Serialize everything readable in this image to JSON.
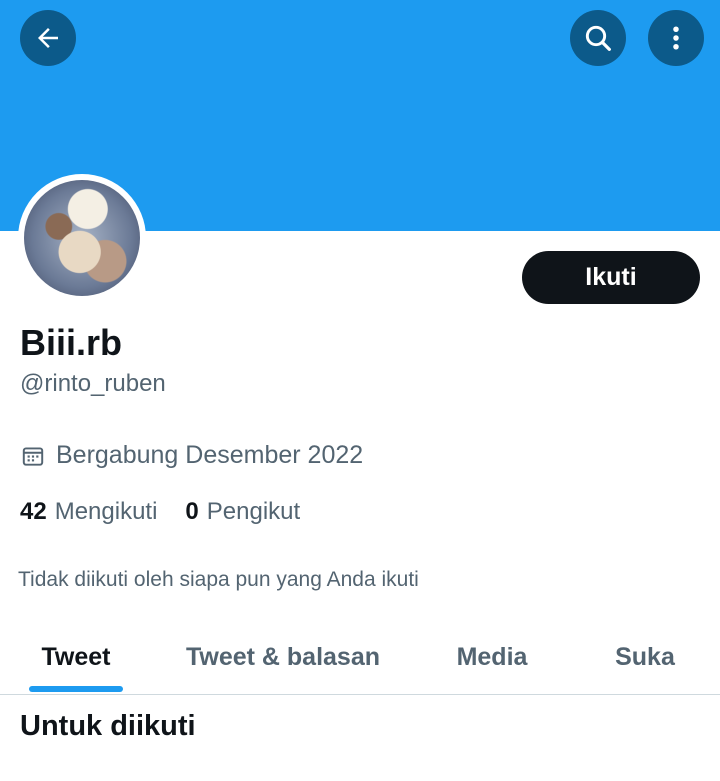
{
  "header": {
    "banner_color": "#1d9bf0",
    "back_icon": "arrow-left-icon",
    "search_icon": "search-icon",
    "more_icon": "more-vertical-icon"
  },
  "profile": {
    "display_name": "Biii.rb",
    "handle": "@rinto_ruben",
    "follow_label": "Ikuti",
    "joined_icon": "calendar-icon",
    "joined_text": "Bergabung Desember 2022",
    "following_count": "42",
    "following_label": "Mengikuti",
    "followers_count": "0",
    "followers_label": "Pengikut",
    "not_followed_text": "Tidak diikuti oleh siapa pun yang Anda ikuti"
  },
  "tabs": [
    {
      "label": "Tweet",
      "active": true
    },
    {
      "label": "Tweet & balasan",
      "active": false
    },
    {
      "label": "Media",
      "active": false
    },
    {
      "label": "Suka",
      "active": false
    }
  ],
  "section": {
    "title": "Untuk diikuti"
  },
  "colors": {
    "accent": "#1d9bf0",
    "text_primary": "#0f1419",
    "text_secondary": "#536471"
  }
}
